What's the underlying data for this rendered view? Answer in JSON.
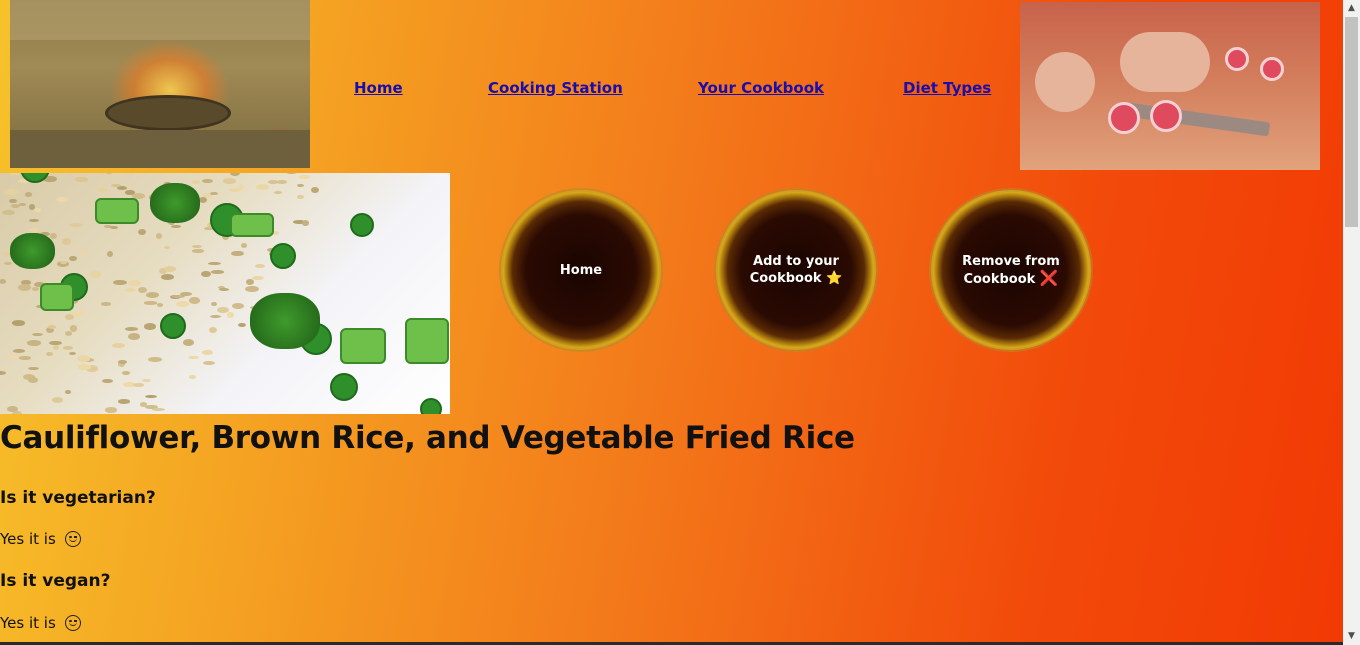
{
  "nav": {
    "items": [
      {
        "label": "Home"
      },
      {
        "label": "Cooking Station"
      },
      {
        "label": "Your Cookbook"
      },
      {
        "label": "Diet Types"
      }
    ]
  },
  "actions": {
    "home": "Home",
    "add_line1": "Add to your",
    "add_line2": "Cookbook",
    "add_icon": "⭐",
    "remove_line1": "Remove from",
    "remove_line2": "Cookbook",
    "remove_icon": "❌"
  },
  "recipe": {
    "title": "Cauliflower, Brown Rice, and Vegetable Fried Rice",
    "q_vegetarian": "Is it vegetarian?",
    "a_vegetarian": "Yes it is",
    "q_vegan": "Is it vegan?",
    "a_vegan": "Yes it is"
  },
  "icons": {
    "answer_icon": "smiley-wink-icon",
    "scroll_up": "scroll-up-arrow-icon",
    "scroll_down": "scroll-down-arrow-icon"
  },
  "colors": {
    "gradient_start": "#f6c22a",
    "gradient_end": "#f23a04",
    "link": "#1a0dab"
  }
}
